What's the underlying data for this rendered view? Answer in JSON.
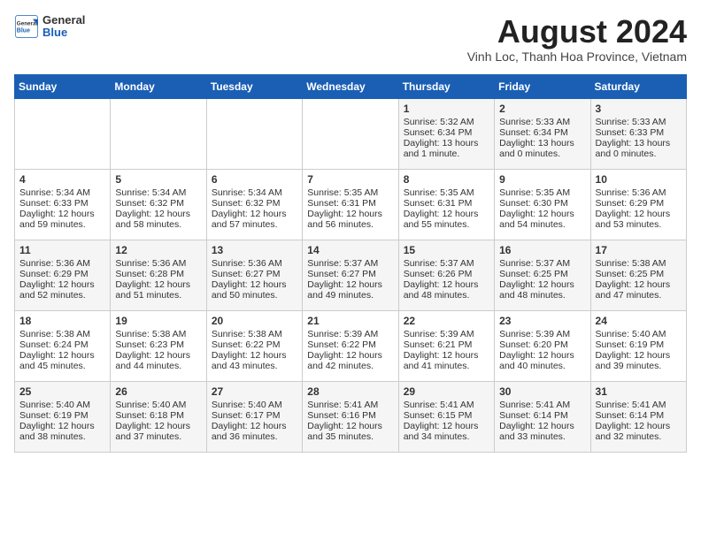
{
  "header": {
    "logo_general": "General",
    "logo_blue": "Blue",
    "month_year": "August 2024",
    "location": "Vinh Loc, Thanh Hoa Province, Vietnam"
  },
  "days_of_week": [
    "Sunday",
    "Monday",
    "Tuesday",
    "Wednesday",
    "Thursday",
    "Friday",
    "Saturday"
  ],
  "weeks": [
    [
      {
        "day": "",
        "content": ""
      },
      {
        "day": "",
        "content": ""
      },
      {
        "day": "",
        "content": ""
      },
      {
        "day": "",
        "content": ""
      },
      {
        "day": "1",
        "content": "Sunrise: 5:32 AM\nSunset: 6:34 PM\nDaylight: 13 hours and 1 minute."
      },
      {
        "day": "2",
        "content": "Sunrise: 5:33 AM\nSunset: 6:34 PM\nDaylight: 13 hours and 0 minutes."
      },
      {
        "day": "3",
        "content": "Sunrise: 5:33 AM\nSunset: 6:33 PM\nDaylight: 13 hours and 0 minutes."
      }
    ],
    [
      {
        "day": "4",
        "content": "Sunrise: 5:34 AM\nSunset: 6:33 PM\nDaylight: 12 hours and 59 minutes."
      },
      {
        "day": "5",
        "content": "Sunrise: 5:34 AM\nSunset: 6:32 PM\nDaylight: 12 hours and 58 minutes."
      },
      {
        "day": "6",
        "content": "Sunrise: 5:34 AM\nSunset: 6:32 PM\nDaylight: 12 hours and 57 minutes."
      },
      {
        "day": "7",
        "content": "Sunrise: 5:35 AM\nSunset: 6:31 PM\nDaylight: 12 hours and 56 minutes."
      },
      {
        "day": "8",
        "content": "Sunrise: 5:35 AM\nSunset: 6:31 PM\nDaylight: 12 hours and 55 minutes."
      },
      {
        "day": "9",
        "content": "Sunrise: 5:35 AM\nSunset: 6:30 PM\nDaylight: 12 hours and 54 minutes."
      },
      {
        "day": "10",
        "content": "Sunrise: 5:36 AM\nSunset: 6:29 PM\nDaylight: 12 hours and 53 minutes."
      }
    ],
    [
      {
        "day": "11",
        "content": "Sunrise: 5:36 AM\nSunset: 6:29 PM\nDaylight: 12 hours and 52 minutes."
      },
      {
        "day": "12",
        "content": "Sunrise: 5:36 AM\nSunset: 6:28 PM\nDaylight: 12 hours and 51 minutes."
      },
      {
        "day": "13",
        "content": "Sunrise: 5:36 AM\nSunset: 6:27 PM\nDaylight: 12 hours and 50 minutes."
      },
      {
        "day": "14",
        "content": "Sunrise: 5:37 AM\nSunset: 6:27 PM\nDaylight: 12 hours and 49 minutes."
      },
      {
        "day": "15",
        "content": "Sunrise: 5:37 AM\nSunset: 6:26 PM\nDaylight: 12 hours and 48 minutes."
      },
      {
        "day": "16",
        "content": "Sunrise: 5:37 AM\nSunset: 6:25 PM\nDaylight: 12 hours and 48 minutes."
      },
      {
        "day": "17",
        "content": "Sunrise: 5:38 AM\nSunset: 6:25 PM\nDaylight: 12 hours and 47 minutes."
      }
    ],
    [
      {
        "day": "18",
        "content": "Sunrise: 5:38 AM\nSunset: 6:24 PM\nDaylight: 12 hours and 45 minutes."
      },
      {
        "day": "19",
        "content": "Sunrise: 5:38 AM\nSunset: 6:23 PM\nDaylight: 12 hours and 44 minutes."
      },
      {
        "day": "20",
        "content": "Sunrise: 5:38 AM\nSunset: 6:22 PM\nDaylight: 12 hours and 43 minutes."
      },
      {
        "day": "21",
        "content": "Sunrise: 5:39 AM\nSunset: 6:22 PM\nDaylight: 12 hours and 42 minutes."
      },
      {
        "day": "22",
        "content": "Sunrise: 5:39 AM\nSunset: 6:21 PM\nDaylight: 12 hours and 41 minutes."
      },
      {
        "day": "23",
        "content": "Sunrise: 5:39 AM\nSunset: 6:20 PM\nDaylight: 12 hours and 40 minutes."
      },
      {
        "day": "24",
        "content": "Sunrise: 5:40 AM\nSunset: 6:19 PM\nDaylight: 12 hours and 39 minutes."
      }
    ],
    [
      {
        "day": "25",
        "content": "Sunrise: 5:40 AM\nSunset: 6:19 PM\nDaylight: 12 hours and 38 minutes."
      },
      {
        "day": "26",
        "content": "Sunrise: 5:40 AM\nSunset: 6:18 PM\nDaylight: 12 hours and 37 minutes."
      },
      {
        "day": "27",
        "content": "Sunrise: 5:40 AM\nSunset: 6:17 PM\nDaylight: 12 hours and 36 minutes."
      },
      {
        "day": "28",
        "content": "Sunrise: 5:41 AM\nSunset: 6:16 PM\nDaylight: 12 hours and 35 minutes."
      },
      {
        "day": "29",
        "content": "Sunrise: 5:41 AM\nSunset: 6:15 PM\nDaylight: 12 hours and 34 minutes."
      },
      {
        "day": "30",
        "content": "Sunrise: 5:41 AM\nSunset: 6:14 PM\nDaylight: 12 hours and 33 minutes."
      },
      {
        "day": "31",
        "content": "Sunrise: 5:41 AM\nSunset: 6:14 PM\nDaylight: 12 hours and 32 minutes."
      }
    ]
  ]
}
